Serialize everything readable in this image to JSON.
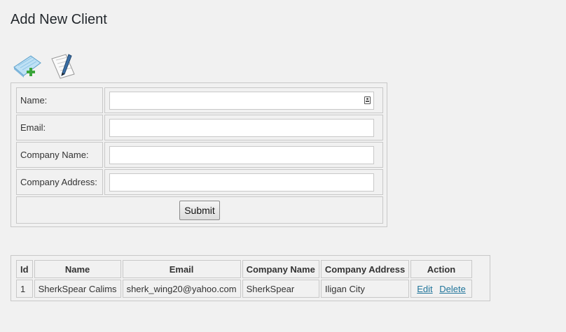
{
  "page": {
    "title": "Add New Client"
  },
  "toolbar": {
    "icons": [
      "add-note-icon",
      "edit-note-icon"
    ]
  },
  "form": {
    "fields": [
      {
        "label": "Name:",
        "value": "",
        "placeholder": ""
      },
      {
        "label": "Email:",
        "value": "",
        "placeholder": ""
      },
      {
        "label": "Company Name:",
        "value": "",
        "placeholder": ""
      },
      {
        "label": "Company Address:",
        "value": "",
        "placeholder": ""
      }
    ],
    "submit_label": "Submit"
  },
  "clients": {
    "headers": [
      "Id",
      "Name",
      "Email",
      "Company Name",
      "Company Address",
      "Action"
    ],
    "rows": [
      {
        "id": "1",
        "name": "SherkSpear Calims",
        "email": "sherk_wing20@yahoo.com",
        "company_name": "SherkSpear",
        "company_address": "Iligan City",
        "edit_label": "Edit",
        "delete_label": "Delete"
      }
    ]
  },
  "colors": {
    "background": "#f1f1f1",
    "link": "#21759b",
    "border": "#c8c8c8"
  }
}
